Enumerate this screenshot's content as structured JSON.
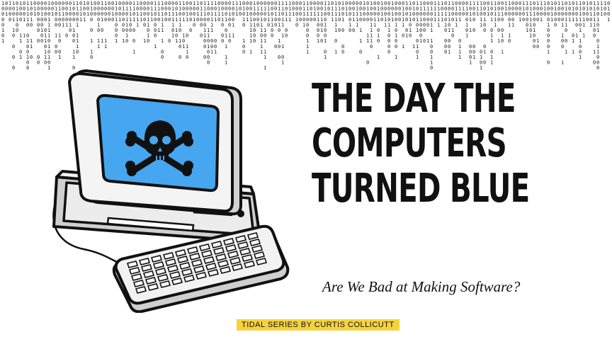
{
  "title": {
    "line1": "THE DAY THE",
    "line2": "COMPUTERS",
    "line3": "TURNED BLUE"
  },
  "subtitle": "Are We Bad at Making Software?",
  "credit": "TIDAL SERIES BY CURTIS COLLICUTT",
  "colors": {
    "screen": "#46a6ef",
    "badge": "#f6d23d",
    "ink": "#111111",
    "case_shadow": "#c9c9c9"
  },
  "icons": {
    "screen_symbol": "skull-and-crossbones-icon",
    "background": "binary-code-rain"
  }
}
